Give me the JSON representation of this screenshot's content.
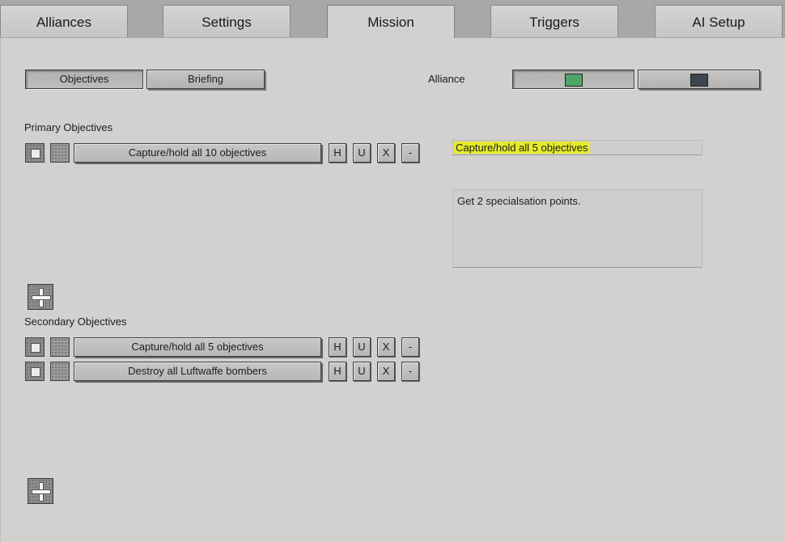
{
  "tabs": [
    "Alliances",
    "Settings",
    "Mission",
    "Triggers",
    "AI Setup"
  ],
  "active_tab": "Mission",
  "subtabs": {
    "objectives": "Objectives",
    "briefing": "Briefing"
  },
  "alliance": {
    "label": "Alliance",
    "colors": [
      "#4ea56a",
      "#3c4550"
    ]
  },
  "primary": {
    "heading": "Primary Objectives",
    "objectives": [
      {
        "name": "Capture/hold all 10 objectives"
      }
    ]
  },
  "secondary": {
    "heading": "Secondary Objectives",
    "objectives": [
      {
        "name": "Capture/hold all 5 objectives"
      },
      {
        "name": "Destroy all Luftwaffe bombers"
      }
    ]
  },
  "row_buttons": {
    "h": "H",
    "u": "U",
    "x": "X",
    "remove": "-"
  },
  "editor": {
    "title": "Capture/hold all 5 objectives",
    "description": "Get 2 specialsation points."
  },
  "icons": {
    "add": "plus-icon",
    "checkbox": "checkbox-icon"
  }
}
